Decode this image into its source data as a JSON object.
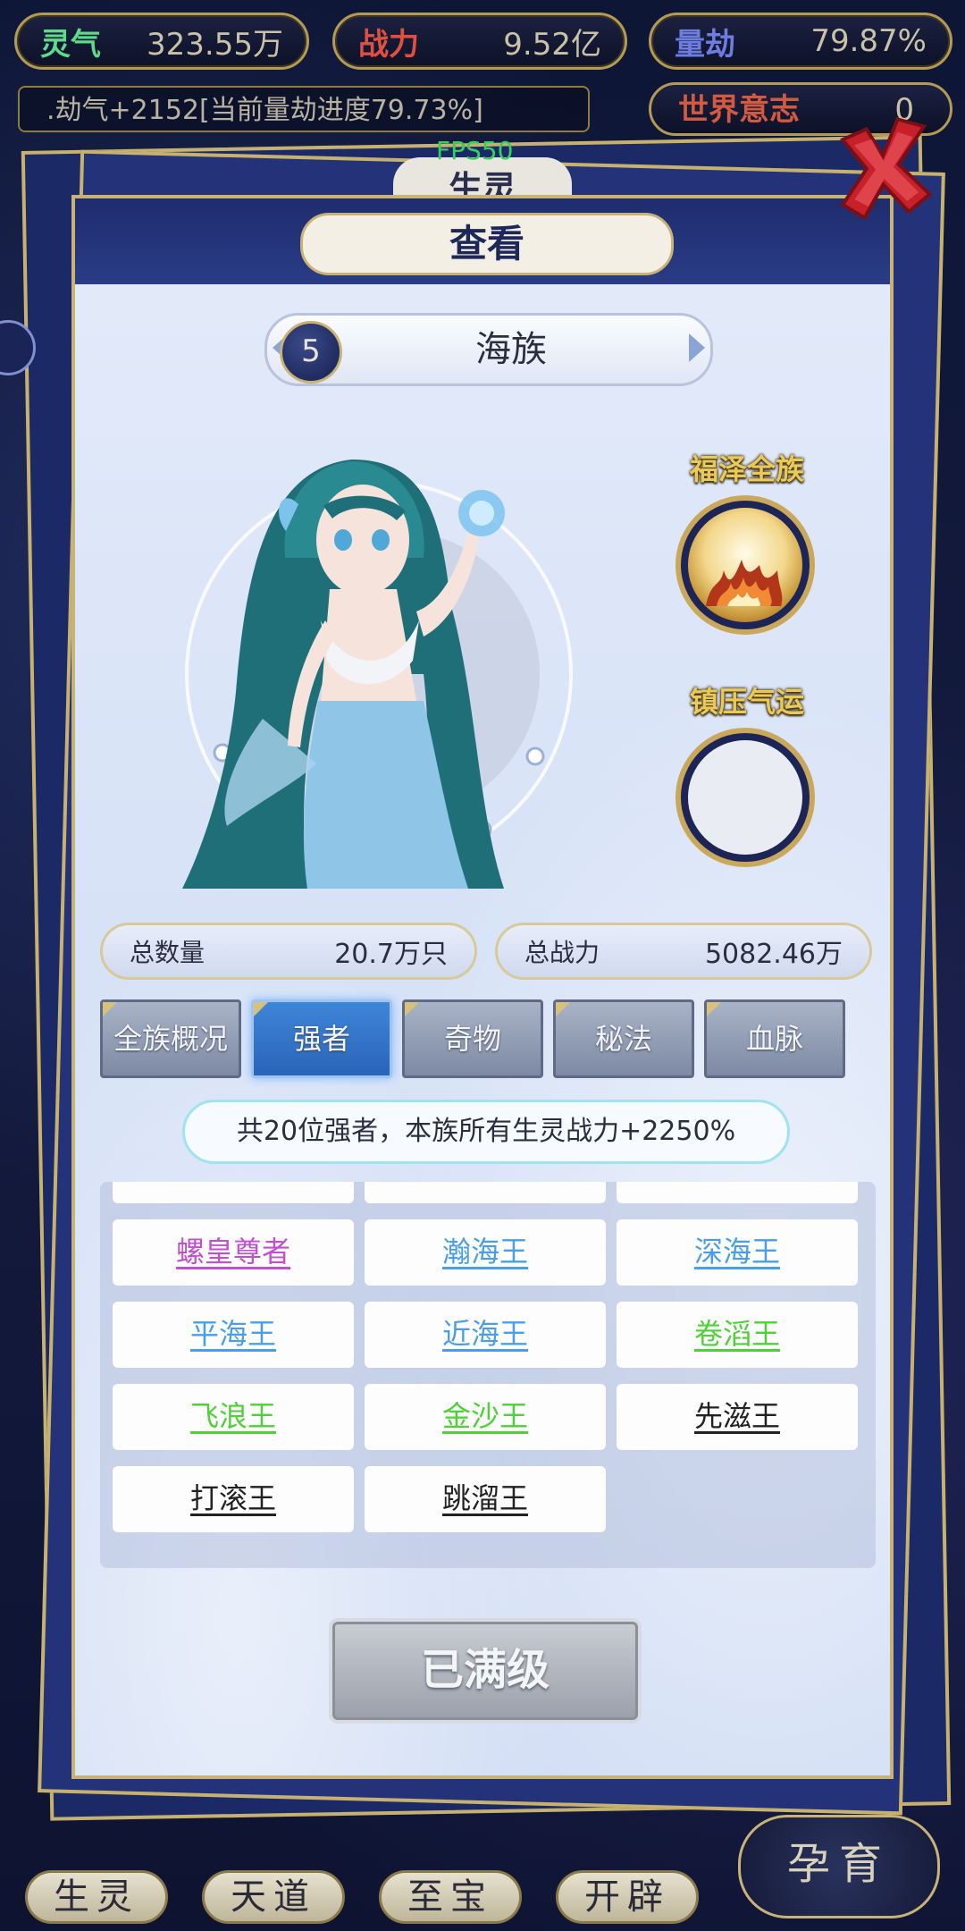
{
  "resources": [
    {
      "label": "灵气",
      "value": "323.55万"
    },
    {
      "label": "战力",
      "value": "9.52亿"
    },
    {
      "label": "量劫",
      "value": "79.87%"
    }
  ],
  "log_text": ".劫气+2152[当前量劫进度79.73%]",
  "world_will": {
    "label": "世界意志",
    "value": "0"
  },
  "fps": "FPS50",
  "background_tab": "生灵",
  "dialog": {
    "title": "查看",
    "race": {
      "level": "5",
      "name": "海族"
    },
    "buffs": [
      {
        "title": "福泽全族"
      },
      {
        "title": "镇压气运"
      }
    ],
    "stats": {
      "total_count_label": "总数量",
      "total_count_value": "20.7万只",
      "total_power_label": "总战力",
      "total_power_value": "5082.46万"
    },
    "tabs": [
      "全族概况",
      "强者",
      "奇物",
      "秘法",
      "血脉"
    ],
    "active_tab": "强者",
    "summary": "共20位强者，本族所有生灵战力+2250%",
    "grid_rows": [
      [
        {
          "name": "螺皇尊者",
          "color": "#c24fcf"
        },
        {
          "name": "瀚海王",
          "color": "#4a9ee6"
        },
        {
          "name": "深海王",
          "color": "#4a9ee6"
        }
      ],
      [
        {
          "name": "平海王",
          "color": "#4a9ee6"
        },
        {
          "name": "近海王",
          "color": "#4a9ee6"
        },
        {
          "name": "卷滔王",
          "color": "#4fcf38"
        }
      ],
      [
        {
          "name": "飞浪王",
          "color": "#4fcf38"
        },
        {
          "name": "金沙王",
          "color": "#4fcf38"
        },
        {
          "name": "先滋王",
          "color": "#222222"
        }
      ],
      [
        {
          "name": "打滚王",
          "color": "#222222"
        },
        {
          "name": "跳溜王",
          "color": "#222222"
        }
      ]
    ],
    "maxed_label": "已满级"
  },
  "bottom_nav": [
    "生灵",
    "天道",
    "至宝",
    "开辟"
  ],
  "breed_label": "孕育",
  "icons": {
    "close": "close-icon",
    "arrow_left": "arrow-left-icon",
    "arrow_right": "arrow-right-icon"
  }
}
